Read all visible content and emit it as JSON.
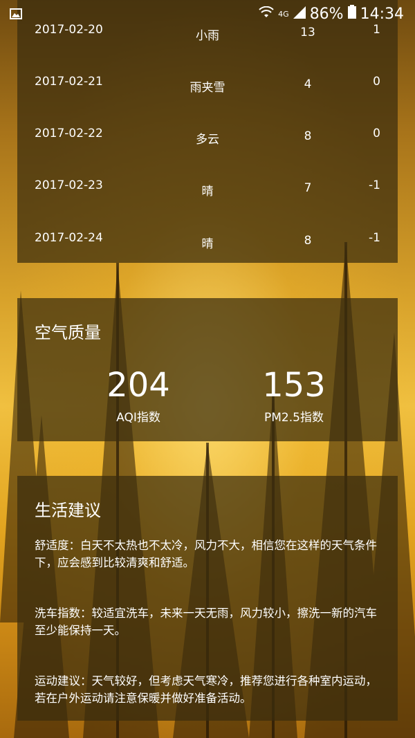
{
  "status": {
    "network": "4G",
    "battery": "86%",
    "time": "14:34"
  },
  "forecast": [
    {
      "date": "2017-02-20",
      "weather": "小雨",
      "high": "13",
      "low": "1"
    },
    {
      "date": "2017-02-21",
      "weather": "雨夹雪",
      "high": "4",
      "low": "0"
    },
    {
      "date": "2017-02-22",
      "weather": "多云",
      "high": "8",
      "low": "0"
    },
    {
      "date": "2017-02-23",
      "weather": "晴",
      "high": "7",
      "low": "-1"
    },
    {
      "date": "2017-02-24",
      "weather": "晴",
      "high": "8",
      "low": "-1"
    }
  ],
  "air": {
    "title": "空气质量",
    "aqi_value": "204",
    "aqi_label": "AQI指数",
    "pm25_value": "153",
    "pm25_label": "PM2.5指数"
  },
  "life": {
    "title": "生活建议",
    "comfort": "舒适度：白天不太热也不太冷，风力不大，相信您在这样的天气条件下，应会感到比较清爽和舒适。",
    "carwash": "洗车指数：较适宜洗车，未来一天无雨，风力较小，擦洗一新的汽车至少能保持一天。",
    "sport": "运动建议：天气较好，但考虑天气寒冷，推荐您进行各种室内运动，若在户外运动请注意保暖并做好准备活动。"
  }
}
